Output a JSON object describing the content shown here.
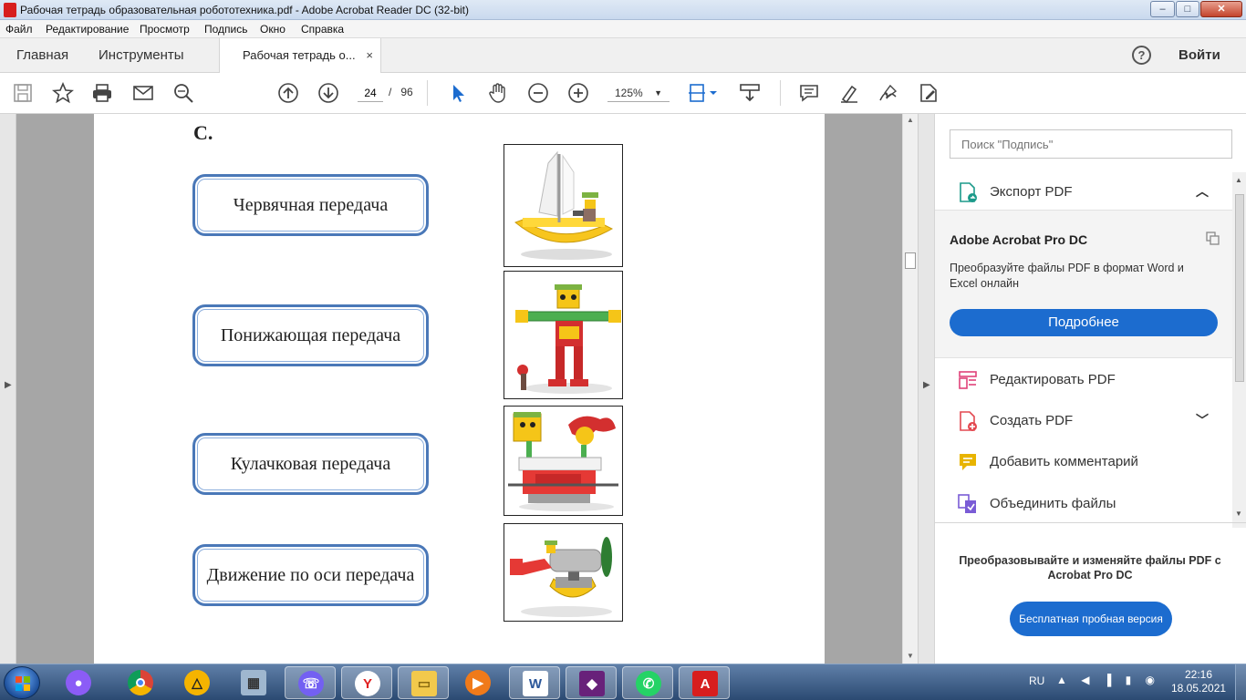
{
  "window": {
    "title": "Рабочая тетрадь образовательная робототехника.pdf - Adobe Acrobat Reader DC (32-bit)",
    "controls": {
      "minimize": "–",
      "maximize": "□",
      "close": "✕"
    }
  },
  "menu": [
    "Файл",
    "Редактирование",
    "Просмотр",
    "Подпись",
    "Окно",
    "Справка"
  ],
  "tabs": {
    "home": "Главная",
    "tools": "Инструменты",
    "document": "Рабочая тетрадь о...",
    "close_glyph": "×",
    "help": "?",
    "signin": "Войти"
  },
  "toolbar": {
    "page_current": "24",
    "page_separator": "/",
    "page_total": "96",
    "zoom": "125%",
    "zoom_caret": "▼",
    "icons": [
      "save-icon",
      "bookmark-star-icon",
      "print-icon",
      "email-icon",
      "find-icon",
      "page-up-icon",
      "page-down-icon",
      "select-cursor-icon",
      "hand-tool-icon",
      "zoom-out-icon",
      "zoom-in-icon",
      "fit-page-icon",
      "scroll-mode-icon",
      "comment-icon",
      "highlight-icon",
      "sign-icon",
      "fill-sign-icon"
    ]
  },
  "document": {
    "section_letter": "С.",
    "gears": [
      "Червячная передача",
      "Понижающая передача",
      "Кулачковая передача",
      "Движение по оси передача"
    ],
    "pictures": [
      "sailboat-model-picture",
      "robot-model-picture",
      "cam-birds-model-picture",
      "plane-model-picture"
    ]
  },
  "right_panel": {
    "search_placeholder": "Поиск \"Подпись\"",
    "export_label": "Экспорт PDF",
    "promo_title": "Adobe Acrobat Pro DC",
    "promo_text": "Преобразуйте файлы PDF в формат Word и Excel онлайн",
    "promo_button": "Подробнее",
    "tools": [
      "Редактировать PDF",
      "Создать PDF",
      "Добавить комментарий",
      "Объединить файлы"
    ],
    "trial_text": "Преобразовывайте и изменяйте файлы PDF с Acrobat Pro DC",
    "trial_button": "Бесплатная пробная версия",
    "colors": {
      "accent": "#1c6ccf",
      "edit": "#e0427a",
      "create": "#e34850",
      "comment": "#e8b400",
      "combine": "#7a5cd6"
    }
  },
  "taskbar": {
    "lang": "RU",
    "time": "22:16",
    "date": "18.05.2021",
    "apps": [
      "alice-icon",
      "chrome-icon",
      "archicad-icon",
      "calculator-icon",
      "viber-icon",
      "yandex-icon",
      "explorer-icon",
      "media-player-icon",
      "word-icon",
      "visual-studio-icon",
      "whatsapp-icon",
      "acrobat-icon"
    ]
  }
}
